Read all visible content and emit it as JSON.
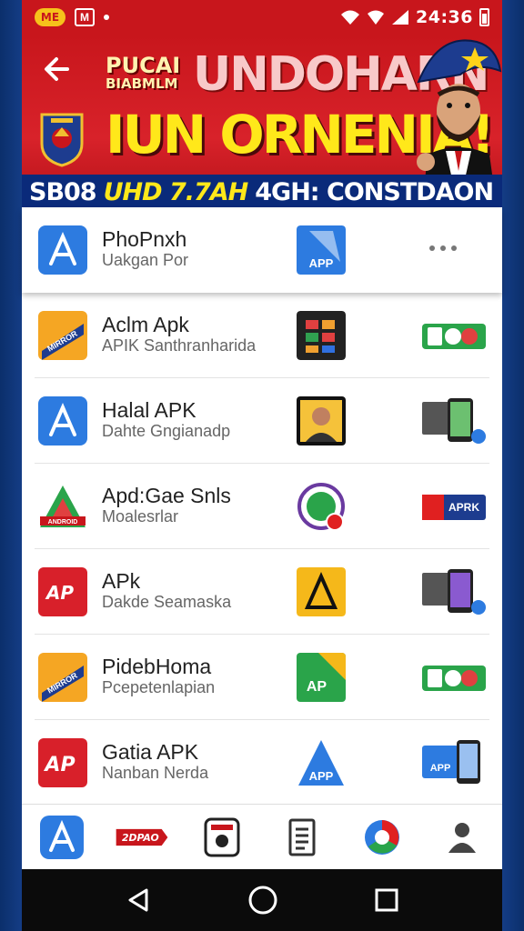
{
  "status_bar": {
    "badge": "ME",
    "m_icon": "M",
    "time": "24:36"
  },
  "banner": {
    "small_line1": "PUCAI",
    "small_line2": "BIABMLM",
    "headline1": "UNDOHARN",
    "headline2": "IUN ORNENIA!",
    "strip_a": "SB08",
    "strip_b": "UHD 7.7AH",
    "strip_c": "4GH: CONSTDAON"
  },
  "list": {
    "rows": [
      {
        "name": "PhoPnxh",
        "subtitle": "Uakgan Por",
        "icon2_label": "APP"
      },
      {
        "name": "Aclm Apk",
        "subtitle": "APIK Santhranharida",
        "icon1_label": "MIRROR"
      },
      {
        "name": "Halal APK",
        "subtitle": "Dahte Gngianadp"
      },
      {
        "name": "Apd:Gae Snls",
        "subtitle": "Moalesrlar",
        "icon1_label": "ANDROID",
        "icon3_label": "APRK"
      },
      {
        "name": "APk",
        "subtitle": "Dakde Seamaska",
        "icon1_label": "AP"
      },
      {
        "name": "PidebHoma",
        "subtitle": "Pcepetenlapian",
        "icon1_label": "MIRROR",
        "icon2_label": "AP"
      },
      {
        "name": "Gatia APK",
        "subtitle": "Nanban Nerda",
        "icon1_label": "AP",
        "icon2_label": "APP",
        "icon3_label": "APP"
      }
    ]
  },
  "bottom_nav": {
    "brand_label": "2DPAO"
  },
  "colors": {
    "brand_red": "#c8161c",
    "navy": "#0a2a7a",
    "yellow": "#ffe81a",
    "app_blue": "#2d7be0"
  }
}
